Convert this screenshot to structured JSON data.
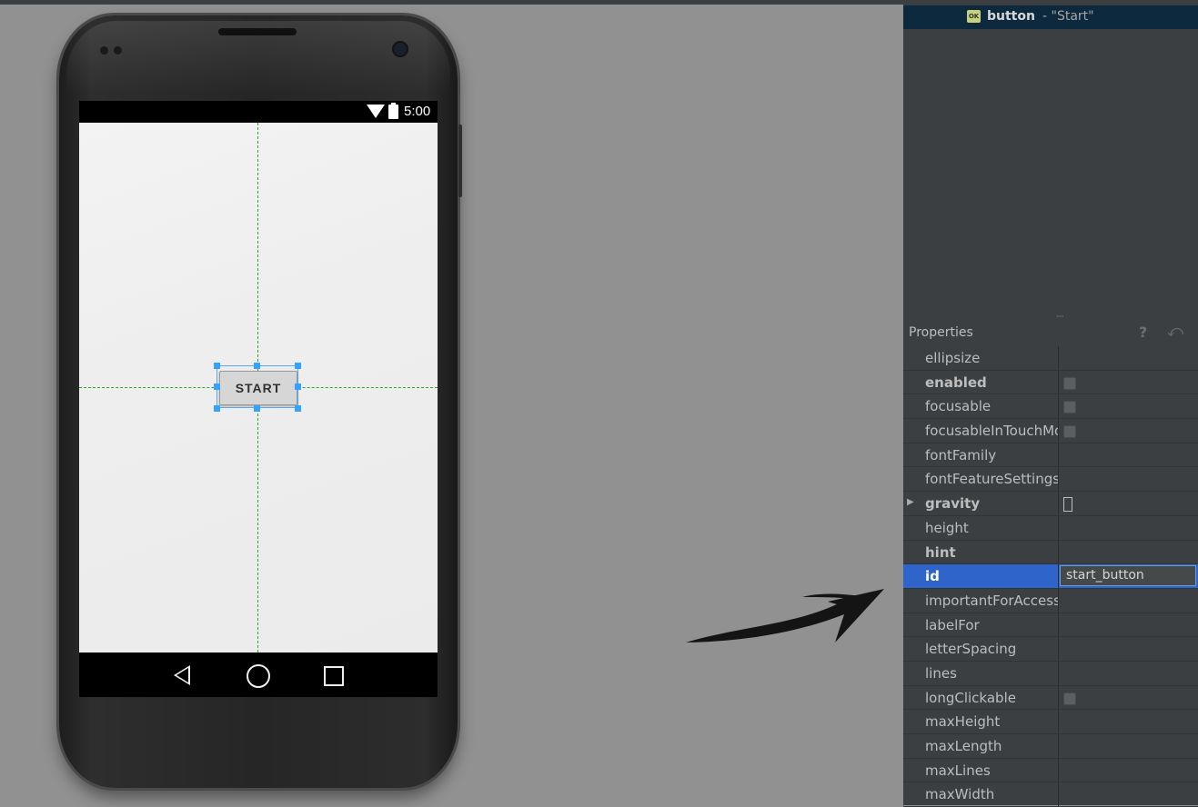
{
  "phone": {
    "status_time": "5:00",
    "start_button_label": "START"
  },
  "tree": {
    "item_name": "button",
    "item_text": "- \"Start\""
  },
  "properties": {
    "title": "Properties",
    "help_icon": "?",
    "undo_icon": "⤺",
    "rows": [
      {
        "name": "ellipsize",
        "bold": false
      },
      {
        "name": "enabled",
        "bold": true,
        "checkbox": true
      },
      {
        "name": "focusable",
        "bold": false,
        "checkbox": true
      },
      {
        "name": "focusableInTouchMode",
        "bold": false,
        "checkbox": true
      },
      {
        "name": "fontFamily",
        "bold": false
      },
      {
        "name": "fontFeatureSettings",
        "bold": false
      },
      {
        "name": "gravity",
        "bold": true
      },
      {
        "name": "height",
        "bold": false
      },
      {
        "name": "hint",
        "bold": true
      },
      {
        "name": "id",
        "bold": true,
        "selected": true,
        "value": "start_button"
      },
      {
        "name": "importantForAccessibility",
        "bold": false
      },
      {
        "name": "labelFor",
        "bold": false
      },
      {
        "name": "letterSpacing",
        "bold": false
      },
      {
        "name": "lines",
        "bold": false
      },
      {
        "name": "longClickable",
        "bold": false,
        "checkbox": true
      },
      {
        "name": "maxHeight",
        "bold": false
      },
      {
        "name": "maxLength",
        "bold": false
      },
      {
        "name": "maxLines",
        "bold": false
      },
      {
        "name": "maxWidth",
        "bold": false
      }
    ]
  },
  "colors": {
    "canvas_bg": "#919191",
    "panel_bg": "#3c3f41",
    "selection_blue": "#2f65ca",
    "guide_green": "#2fa82f",
    "handle_blue": "#33a3ff"
  }
}
